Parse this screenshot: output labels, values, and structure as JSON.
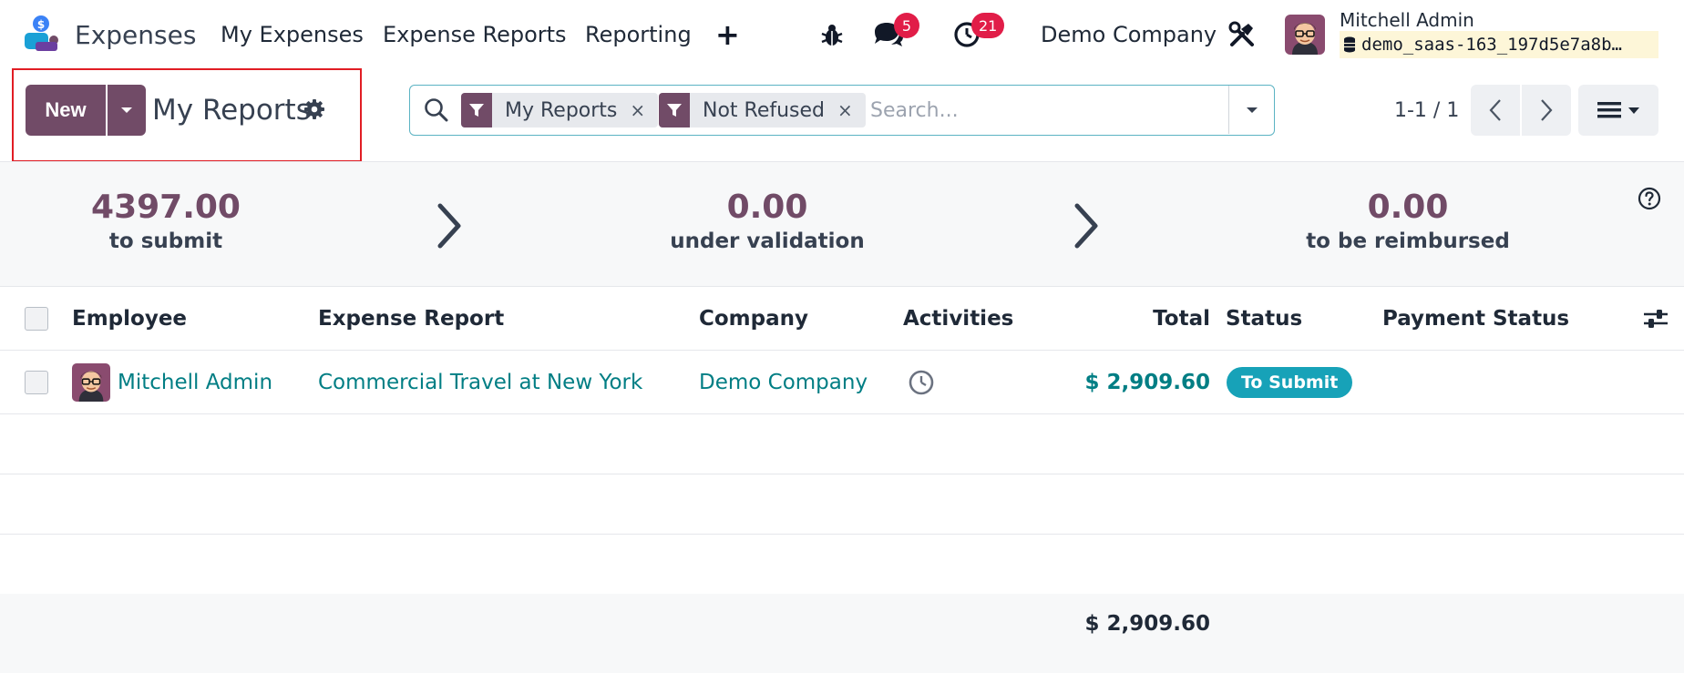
{
  "navbar": {
    "app_name": "Expenses",
    "menu": [
      "My Expenses",
      "Expense Reports",
      "Reporting"
    ],
    "plus_label": "+",
    "messages_count": "5",
    "activities_count": "21",
    "company": "Demo Company",
    "user_name": "Mitchell Admin",
    "database": "demo_saas-163_197d5e7a8b…"
  },
  "control_panel": {
    "new_label": "New",
    "title": "My Reports",
    "search": {
      "facets": [
        "My Reports",
        "Not Refused"
      ],
      "remove_glyph": "×",
      "placeholder": "Search..."
    },
    "pager": "1-1 / 1"
  },
  "dashboard": {
    "stats": [
      {
        "value": "4397.00",
        "label": "to submit"
      },
      {
        "value": "0.00",
        "label": "under validation"
      },
      {
        "value": "0.00",
        "label": "to be reimbursed"
      }
    ]
  },
  "table": {
    "columns": [
      "Employee",
      "Expense Report",
      "Company",
      "Activities",
      "Total",
      "Status",
      "Payment Status"
    ],
    "rows": [
      {
        "employee": "Mitchell Admin",
        "report": "Commercial Travel at New York",
        "company": "Demo Company",
        "total": "$ 2,909.60",
        "status": "To Submit",
        "payment_status": ""
      }
    ],
    "sum_total": "$ 2,909.60"
  },
  "colors": {
    "brand": "#714b67",
    "link": "#017e84",
    "status_badge": "#17a2b8",
    "notification_badge": "#e11d48",
    "highlight_frame": "#e11d24"
  }
}
